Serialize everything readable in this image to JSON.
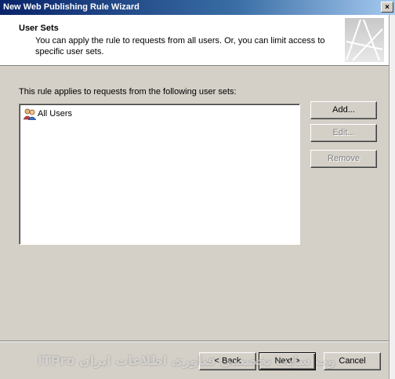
{
  "window": {
    "title": "New Web Publishing Rule Wizard",
    "close_glyph": "×"
  },
  "header": {
    "title": "User Sets",
    "subtitle": "You can apply the rule to requests from all users. Or, you can limit access to specific user sets."
  },
  "content": {
    "label": "This rule applies to requests from the following user sets:",
    "user_sets": [
      {
        "label": "All Users",
        "icon": "users-group-icon"
      }
    ]
  },
  "side_buttons": {
    "add": "Add...",
    "edit": "Edit...",
    "remove": "Remove"
  },
  "footer": {
    "back": "< Back",
    "next": "Next >",
    "cancel": "Cancel"
  },
  "watermark": {
    "text": "وب سایت تخصصی فناوری اطلاعات ایران  ITPro"
  }
}
